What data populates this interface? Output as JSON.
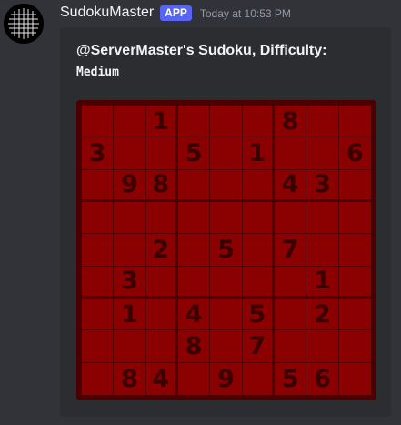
{
  "bot": {
    "name": "SudokuMaster",
    "tag": "APP",
    "timestamp": "Today at 10:53 PM",
    "avatar_icon": "sudoku-grid-avatar-icon"
  },
  "embed": {
    "title": "@ServerMaster's Sudoku, Difficulty:",
    "difficulty": "Medium"
  },
  "colors": {
    "board_background": "#8b0000",
    "board_border": "#4a0000",
    "digit": "#3a0000",
    "tag": "#5865f2"
  },
  "board": {
    "cells": [
      [
        "",
        "",
        "1",
        "",
        "",
        "",
        "8",
        "",
        ""
      ],
      [
        "3",
        "",
        "",
        "5",
        "",
        "1",
        "",
        "",
        "6"
      ],
      [
        "",
        "9",
        "8",
        "",
        "",
        "",
        "4",
        "3",
        ""
      ],
      [
        "",
        "",
        "",
        "",
        "",
        "",
        "",
        "",
        ""
      ],
      [
        "",
        "",
        "2",
        "",
        "5",
        "",
        "7",
        "",
        ""
      ],
      [
        "",
        "3",
        "",
        "",
        "",
        "",
        "",
        "1",
        ""
      ],
      [
        "",
        "1",
        "",
        "4",
        "",
        "5",
        "",
        "2",
        ""
      ],
      [
        "",
        "",
        "",
        "8",
        "",
        "7",
        "",
        "",
        ""
      ],
      [
        "",
        "8",
        "4",
        "",
        "9",
        "",
        "5",
        "6",
        ""
      ]
    ]
  }
}
